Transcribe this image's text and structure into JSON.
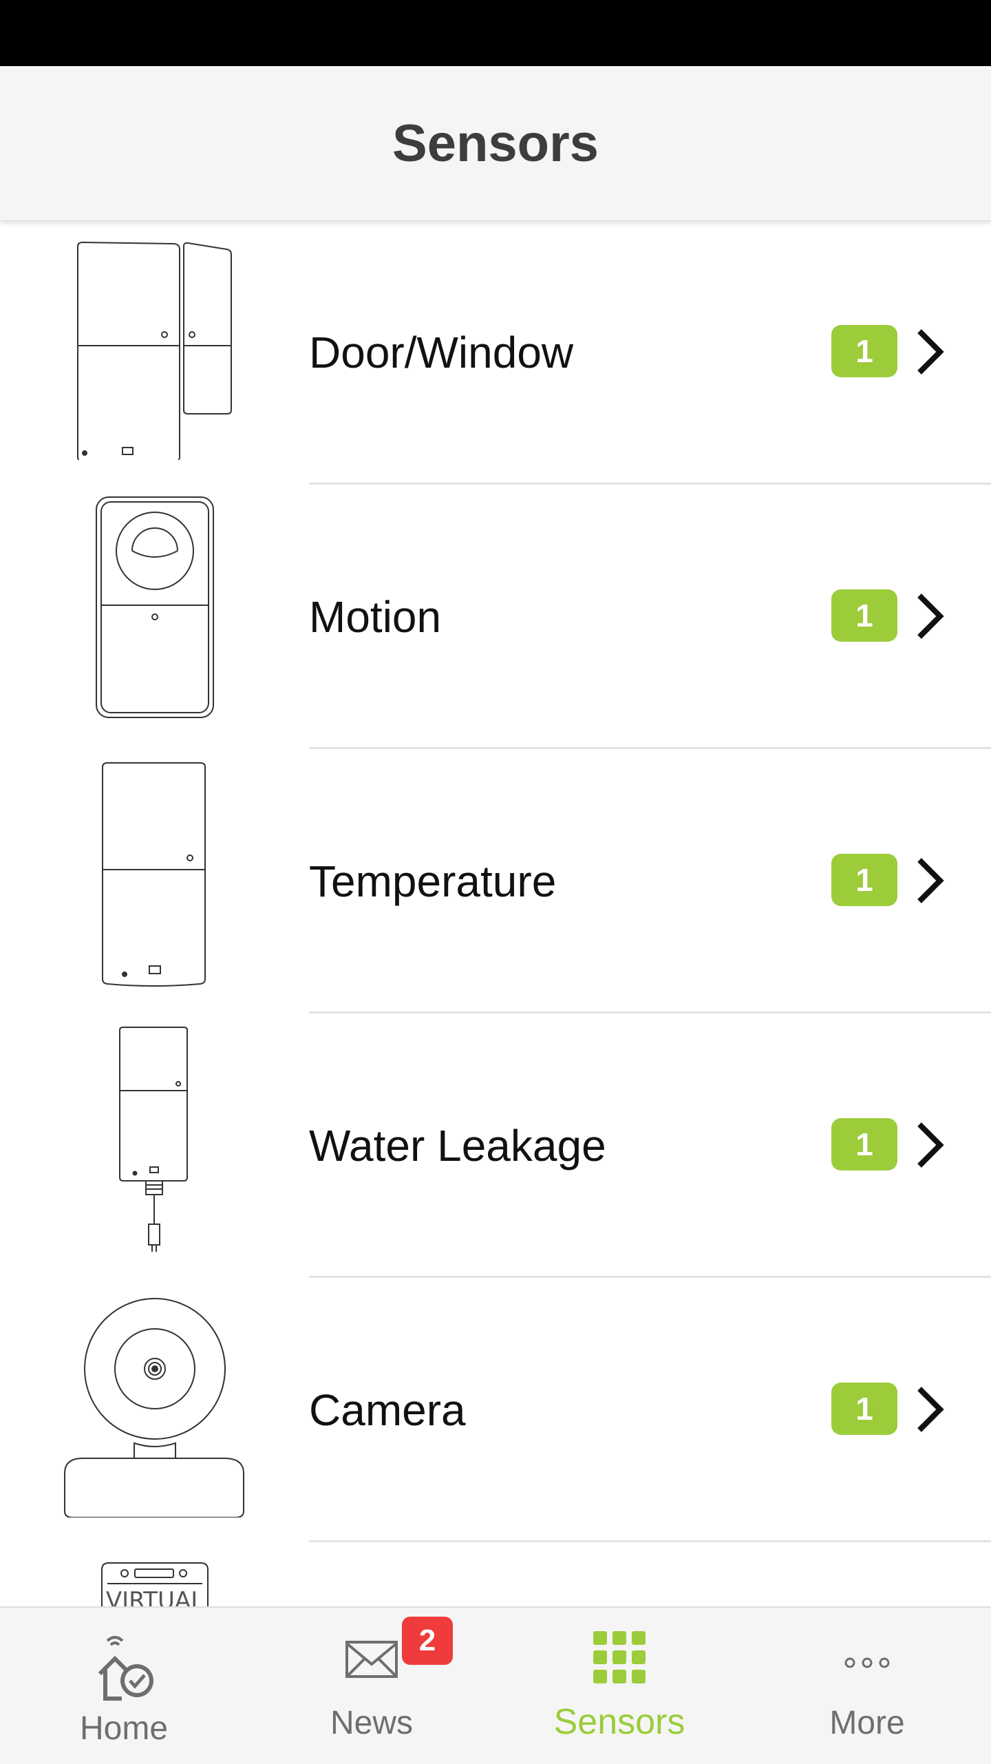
{
  "header": {
    "title": "Sensors"
  },
  "sensors": [
    {
      "label": "Door/Window",
      "count": "1"
    },
    {
      "label": "Motion",
      "count": "1"
    },
    {
      "label": "Temperature",
      "count": "1"
    },
    {
      "label": "Water Leakage",
      "count": "1"
    },
    {
      "label": "Camera",
      "count": "1"
    }
  ],
  "partial_item": {
    "thumb_text": "VIRTUAL"
  },
  "tabbar": {
    "tabs": [
      {
        "label": "Home",
        "icon": "home-check-icon"
      },
      {
        "label": "News",
        "icon": "envelope-icon",
        "badge": "2"
      },
      {
        "label": "Sensors",
        "icon": "grid-icon",
        "active": true
      },
      {
        "label": "More",
        "icon": "more-dots-icon"
      }
    ]
  },
  "colors": {
    "accent": "#9ccc3a",
    "badge_red": "#ef3b3b",
    "header_bg": "#f5f5f5",
    "status_bar": "#000000"
  }
}
